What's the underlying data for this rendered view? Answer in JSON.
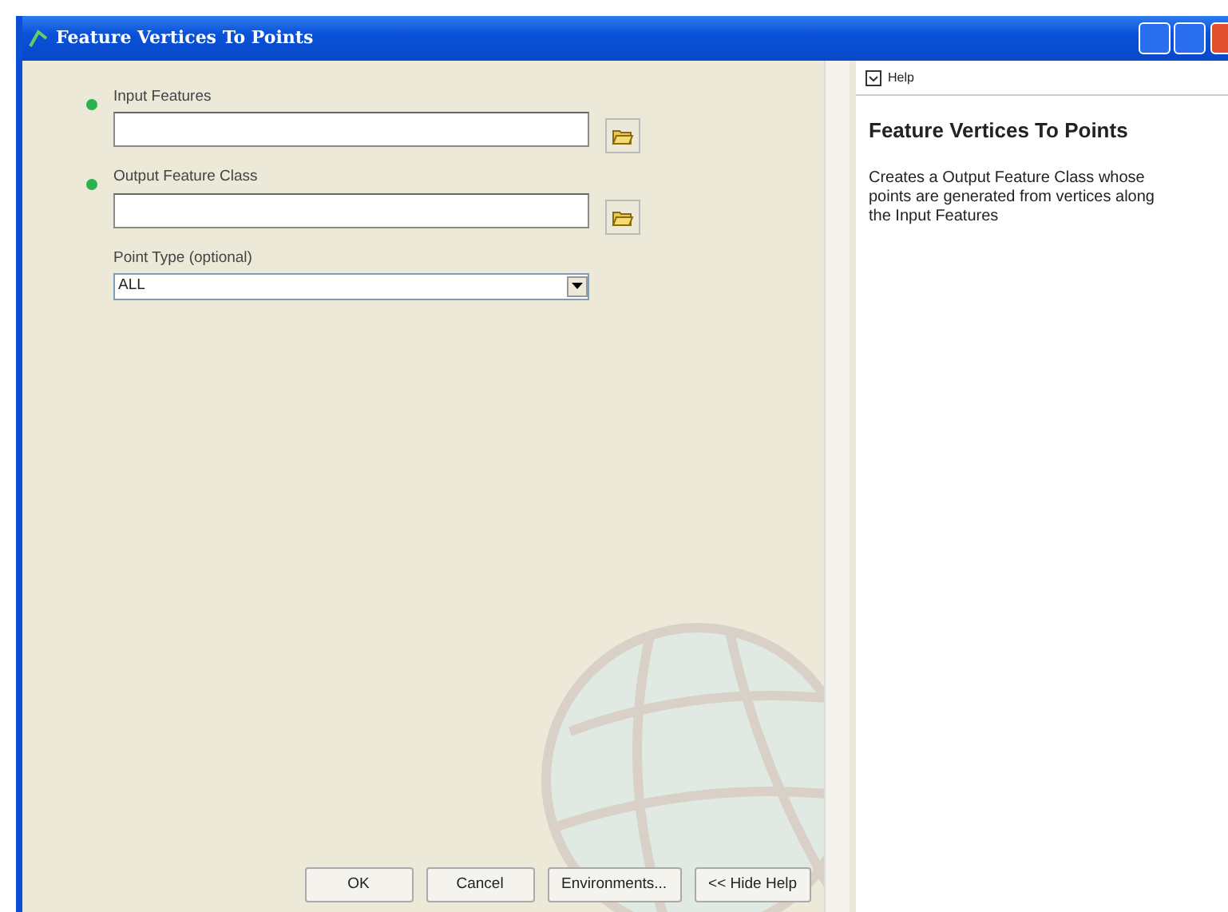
{
  "window": {
    "title": "Feature Vertices To Points"
  },
  "parameters": [
    {
      "kind": "path",
      "label": "Input Features",
      "required": true
    },
    {
      "kind": "path",
      "label": "Output Feature Class",
      "required": true
    },
    {
      "kind": "dropdown",
      "label": "Point Type (optional)",
      "required": false,
      "value": "ALL"
    }
  ],
  "buttons": [
    "OK",
    "Cancel",
    "Environments...",
    "<< Hide Help"
  ],
  "help": {
    "header": "Help",
    "title": "Feature Vertices To Points",
    "text": "Creates a Output Feature Class whose points are generated from vertices along the Input Features"
  }
}
